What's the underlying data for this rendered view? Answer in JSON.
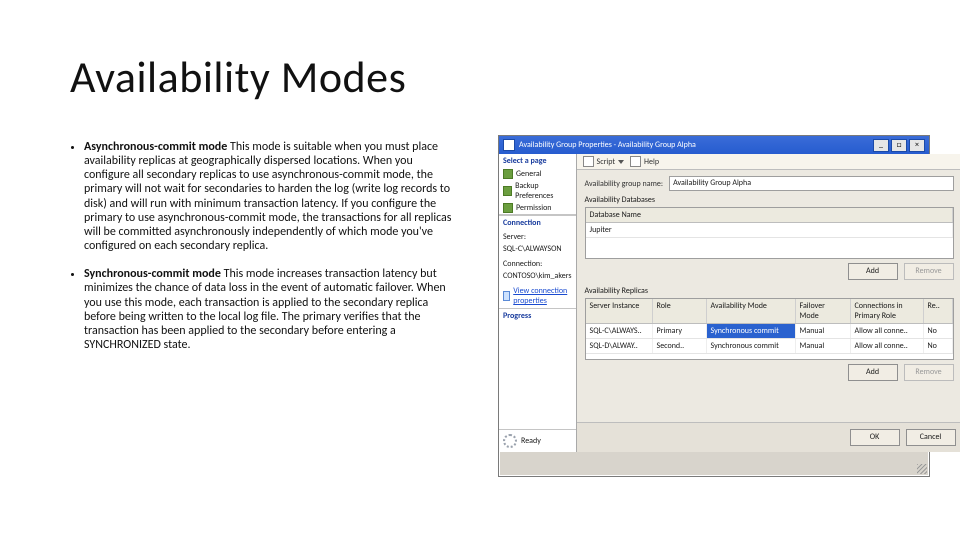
{
  "title": "Availability Modes",
  "bullets": [
    {
      "term": "Asynchronous-commit mode",
      "text": " This mode is suitable when you must place availability replicas at geographically dispersed locations. When you configure all secondary replicas to use asynchronous-commit mode, the primary will not wait for secondaries to harden the log (write log records to disk) and will run with minimum transaction latency. If you configure the primary to use asynchronous-commit mode, the transactions for all replicas will be committed asynchronously independently of which mode you've configured on each secondary replica."
    },
    {
      "term": "Synchronous-commit mode",
      "text": " This mode increases transaction latency but minimizes the chance of data loss in the event of automatic failover. When you use this mode, each transaction is applied to the secondary replica before being written to the local log file. The primary verifies that the transaction has been applied to the secondary before entering a SYNCHRONIZED state."
    }
  ],
  "dialog": {
    "title": "Availability Group Properties - Availability Group Alpha",
    "winbtns": {
      "min": "_",
      "max": "□",
      "close": "×"
    },
    "nav": {
      "pageHeader": "Select a page",
      "pages": [
        "General",
        "Backup Preferences",
        "Permission"
      ],
      "connHeader": "Connection",
      "serverLabel": "Server:",
      "server": "SQL-C\\ALWAYSON",
      "connLabel": "Connection:",
      "conn": "CONTOSO\\kim_akers",
      "viewLink": "View connection properties",
      "progHeader": "Progress",
      "progStatus": "Ready"
    },
    "ribbon": {
      "script": "Script",
      "help": "Help"
    },
    "fields": {
      "agnameLabel": "Availability group name:",
      "agname": "Availability Group Alpha"
    },
    "section1": {
      "label": "Availability Databases",
      "header": "Database Name",
      "rows": [
        "Jupiter"
      ]
    },
    "section2": {
      "label": "Availability Replicas",
      "headers": [
        "Server Instance",
        "Role",
        "Availability Mode",
        "Failover Mode",
        "Connections in Primary Role",
        "Re.."
      ],
      "rows": [
        [
          "SQL-C\\ALWAYS..",
          "Primary",
          "Synchronous commit",
          "Manual",
          "Allow all conne..",
          "No"
        ],
        [
          "SQL-D\\ALWAY..",
          "Second..",
          "Synchronous commit",
          "Manual",
          "Allow all conne..",
          "No"
        ]
      ],
      "selected": {
        "row": 0,
        "col": 2
      }
    },
    "buttons": {
      "add": "Add",
      "remove": "Remove",
      "ok": "OK",
      "cancel": "Cancel"
    }
  }
}
